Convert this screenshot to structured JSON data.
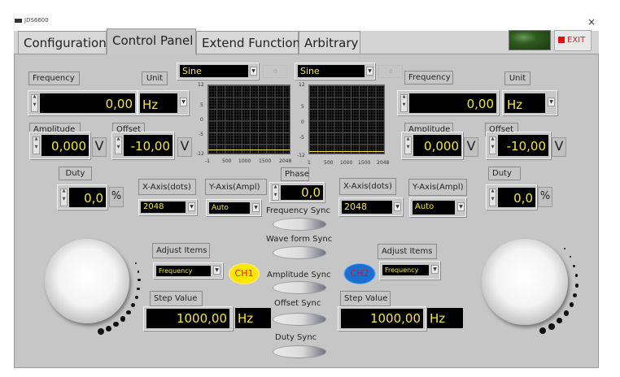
{
  "window": {
    "title": "JDS6600",
    "close": "×"
  },
  "tabs": [
    {
      "label": "Configuration"
    },
    {
      "label": "Control Panel"
    },
    {
      "label": "Extend Function"
    },
    {
      "label": "Arbitrary"
    }
  ],
  "exit_label": "EXIT",
  "ch1": {
    "frequency_label": "Frequency",
    "frequency": "0,00",
    "unit_label": "Unit",
    "unit": "Hz",
    "amplitude_label": "Amplitude",
    "amplitude": "0,000",
    "amplitude_unit": "V",
    "offset_label": "Offset",
    "offset": "-10,00",
    "offset_unit": "V",
    "duty_label": "Duty",
    "duty": "0,0",
    "duty_unit": "%",
    "waveform": "Sine",
    "wave_index": "0",
    "xaxis_label": "X-Axis(dots)",
    "xaxis": "2048",
    "yaxis_label": "Y-Axis(Ampl)",
    "yaxis": "Auto",
    "adjust_label": "Adjust Items",
    "adjust": "Frequency",
    "badge": "CH1",
    "step_label": "Step Value",
    "step": "1000,00",
    "step_unit": "Hz"
  },
  "ch2": {
    "frequency_label": "Frequency",
    "frequency": "0,00",
    "unit_label": "Unit",
    "unit": "Hz",
    "amplitude_label": "Amplitude",
    "amplitude": "0,000",
    "amplitude_unit": "V",
    "offset_label": "Offset",
    "offset": "-10,00",
    "offset_unit": "V",
    "duty_label": "Duty",
    "duty": "0,0",
    "duty_unit": "%",
    "waveform": "Sine",
    "wave_index": "0",
    "xaxis_label": "X-Axis(dots)",
    "xaxis": "2048",
    "yaxis_label": "Y-Axis(Ampl)",
    "yaxis": "Auto",
    "adjust_label": "Adjust Items",
    "adjust": "Frequency",
    "badge": "CH2",
    "step_label": "Step Value",
    "step": "1000,00",
    "step_unit": "Hz"
  },
  "phase": {
    "label": "Phase",
    "value": "0,0"
  },
  "sync": [
    {
      "label": "Frequency Sync"
    },
    {
      "label": "Wave form Sync"
    },
    {
      "label": "Amplitude Sync"
    },
    {
      "label": "Offset Sync"
    },
    {
      "label": "Duty Sync"
    }
  ],
  "graph1": {
    "y_ticks": [
      "12",
      "5",
      "0",
      "-5",
      "-12"
    ],
    "x_ticks": [
      "-1",
      "500",
      "1000",
      "1500",
      "2048"
    ]
  },
  "graph2": {
    "y_ticks": [
      "12",
      "5",
      "0",
      "-5",
      "-12"
    ],
    "x_ticks": [
      "1",
      "500",
      "1000",
      "1500",
      "2048"
    ]
  }
}
